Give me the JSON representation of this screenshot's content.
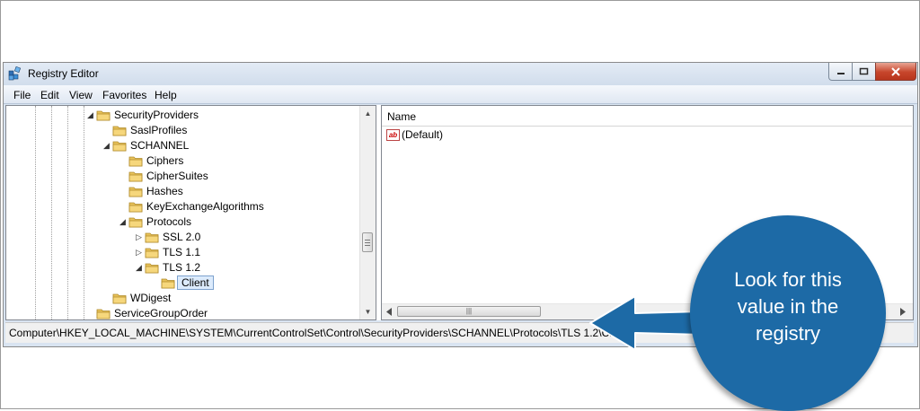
{
  "window": {
    "title": "Registry Editor"
  },
  "menu": [
    "File",
    "Edit",
    "View",
    "Favorites",
    "Help"
  ],
  "tree": [
    {
      "label": "SecurityProviders",
      "expander": "◢"
    },
    {
      "label": "SaslProfiles",
      "expander": ""
    },
    {
      "label": "SCHANNEL",
      "expander": "◢"
    },
    {
      "label": "Ciphers",
      "expander": ""
    },
    {
      "label": "CipherSuites",
      "expander": ""
    },
    {
      "label": "Hashes",
      "expander": ""
    },
    {
      "label": "KeyExchangeAlgorithms",
      "expander": ""
    },
    {
      "label": "Protocols",
      "expander": "◢"
    },
    {
      "label": "SSL 2.0",
      "expander": "▷"
    },
    {
      "label": "TLS 1.1",
      "expander": "▷"
    },
    {
      "label": "TLS 1.2",
      "expander": "◢"
    },
    {
      "label": "Client",
      "expander": "",
      "selected": true
    },
    {
      "label": "WDigest",
      "expander": ""
    },
    {
      "label": "ServiceGroupOrder",
      "expander": ""
    }
  ],
  "list": {
    "column_name": "Name",
    "rows": [
      {
        "icon": "ab",
        "name": "(Default)"
      }
    ]
  },
  "statusbar": {
    "path": "Computer\\HKEY_LOCAL_MACHINE\\SYSTEM\\CurrentControlSet\\Control\\SecurityProviders\\SCHANNEL\\Protocols\\TLS 1.2\\Client"
  },
  "callout": {
    "lines": [
      "Look for this",
      "value in the",
      "registry"
    ]
  },
  "colors": {
    "callout": "#1d6aa6",
    "selection": "#dcebfc",
    "close_button": "#c7452b"
  }
}
